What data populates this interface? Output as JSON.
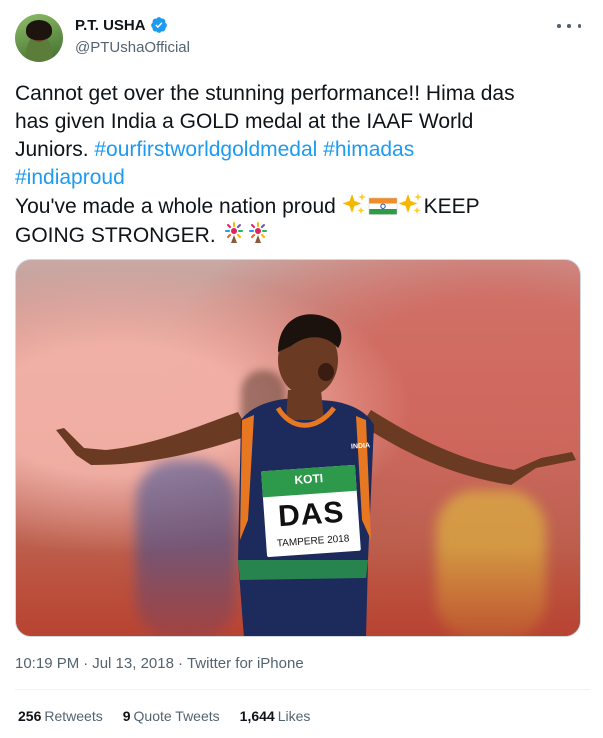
{
  "author": {
    "name": "P.T. USHA",
    "handle": "@PTUshaOfficial",
    "verified": true
  },
  "tweet": {
    "line1": "Cannot get over the stunning performance!! Hima das",
    "line2": "has given India a GOLD medal at the IAAF World",
    "line3_text": "Juniors. ",
    "hashtag1": "#ourfirstworldgoldmedal",
    "hashtag2": "#himadas",
    "hashtag3": "#indiaproud",
    "line5_text": "You've made a whole nation proud ",
    "line5_end": "KEEP",
    "line6_text": "GOING STRONGER. ",
    "emoji": [
      "sparkles-icon",
      "india-flag-icon",
      "sparkles-icon",
      "fireworks-icon",
      "fireworks-icon"
    ]
  },
  "photo": {
    "bib_sponsor": "KOTI",
    "bib_name": "DAS",
    "bib_event": "TAMPERE 2018",
    "jersey_text": "INDIA"
  },
  "meta": {
    "time": "10:19 PM",
    "date": "Jul 13, 2018",
    "source": "Twitter for iPhone",
    "separator": "·"
  },
  "stats": {
    "retweets_count": "256",
    "retweets_label": "Retweets",
    "quotes_count": "9",
    "quotes_label": "Quote Tweets",
    "likes_count": "1,644",
    "likes_label": "Likes"
  },
  "colors": {
    "link": "#1d9bf0",
    "text": "#0f1419",
    "secondary": "#536471",
    "verified": "#1d9bf0"
  }
}
